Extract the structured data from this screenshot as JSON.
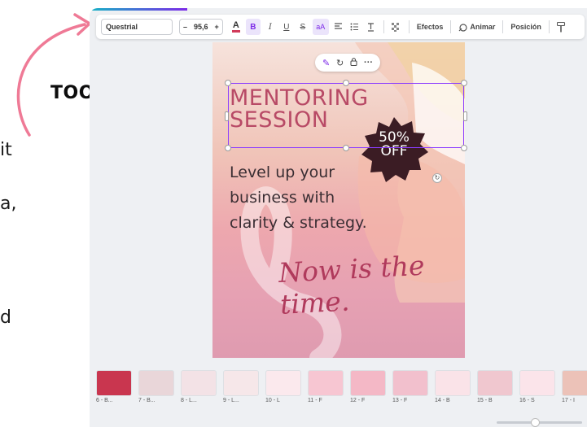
{
  "left_fragments": [
    "it",
    "a,",
    "d"
  ],
  "callout": {
    "label": "TOOLBAR",
    "arrow_color": "#ef7a96"
  },
  "toolbar": {
    "font_name": "Questrial",
    "font_size": "95,6",
    "decrease": "–",
    "increase": "+",
    "text_color_glyph": "A",
    "bold_glyph": "B",
    "italic_glyph": "I",
    "underline_glyph": "U",
    "strike_glyph": "S",
    "case_glyph": "aA",
    "effects_label": "Efectos",
    "animate_label": "Animar",
    "position_label": "Posición"
  },
  "design": {
    "heading_line1": "MENTORING",
    "heading_line2": "SESSION",
    "badge_line1": "50%",
    "badge_line2": "OFF",
    "body_line1": "Level up your",
    "body_line2": "business with",
    "body_line3": "clarity & strategy.",
    "script_text": "Now is the time.",
    "colors": {
      "heading": "#b84a66",
      "badge": "#3b1c24",
      "selection": "#8b3dff"
    }
  },
  "pages": [
    {
      "label": "6 - B..."
    },
    {
      "label": "7 - B..."
    },
    {
      "label": "8 - L..."
    },
    {
      "label": "9 - L..."
    },
    {
      "label": "10 - L"
    },
    {
      "label": "11 - F"
    },
    {
      "label": "12 - F"
    },
    {
      "label": "13 - F"
    },
    {
      "label": "14 - B"
    },
    {
      "label": "15 - B"
    },
    {
      "label": "16 - S"
    },
    {
      "label": "17 - I"
    }
  ]
}
